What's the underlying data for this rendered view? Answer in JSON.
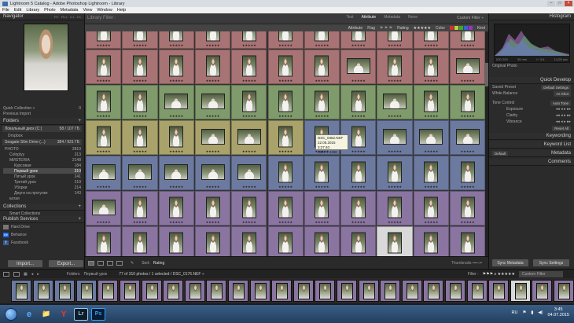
{
  "window": {
    "title": "Lightroom 5 Catalog - Adobe Photoshop Lightroom - Library",
    "controls": [
      "–",
      "□",
      "×"
    ]
  },
  "menu": [
    "File",
    "Edit",
    "Library",
    "Photo",
    "Metadata",
    "View",
    "Window",
    "Help"
  ],
  "left_panel": {
    "navigator_title": "Navigator",
    "navigator_zoom": [
      "FIT",
      "FILL",
      "1:1",
      "3:1"
    ],
    "catalog_items": [
      {
        "label": "Quick Collection +",
        "count": "0"
      },
      {
        "label": "Previous Import",
        "count": ""
      }
    ],
    "folders_title": "Folders",
    "volumes": [
      {
        "label": "Локальный диск (C:)",
        "info": "58 / 107 ГБ"
      },
      {
        "label": "Seagate Slim Drive (...)",
        "info": "384 / 931 ГБ"
      }
    ],
    "folders": [
      {
        "label": "Dropbox",
        "count": ""
      },
      {
        "label": "PHOTO",
        "count": "2810"
      },
      {
        "label": "Coloplyy",
        "count": "313"
      },
      {
        "label": "МИSTERIA",
        "count": "2148"
      },
      {
        "label": "Курсовая",
        "count": "184"
      },
      {
        "label": "Первый урок",
        "count": "310",
        "selected": true
      },
      {
        "label": "Пятый урок",
        "count": "241"
      },
      {
        "label": "Третий урок",
        "count": "219"
      },
      {
        "label": "Уборки",
        "count": "214"
      },
      {
        "label": "Джуги на прогулке",
        "count": "143"
      },
      {
        "label": "катая",
        "count": ""
      }
    ],
    "collections_title": "Collections",
    "smart_collections": "Smart Collections",
    "publish_title": "Publish Services",
    "publish_items": [
      "Hard Drive",
      "Behance",
      "Facebook"
    ],
    "import_label": "Import...",
    "export_label": "Export..."
  },
  "center": {
    "filter_title": "Library Filter :",
    "filter_tabs": [
      "Text",
      "Attribute",
      "Metadata",
      "None"
    ],
    "filter_custom": "Custom Filter ÷",
    "attr_items": [
      "Attribute",
      "Flag",
      "Rating",
      "★★★★★",
      "Color",
      "Kind"
    ],
    "tooltip": {
      "name": "DSC_0382.NEF",
      "date": "22.05.2015 3:27:40",
      "size": "2848 x 4288"
    },
    "sort_label": "Sort:",
    "sort_value": "Rating",
    "thumbnails_label": "Thumbnails"
  },
  "right_panel": {
    "histogram_title": "Histogram",
    "hist_readout": [
      "ISO 200",
      "35 mm",
      "f / 3.5",
      "1/125 sec"
    ],
    "original_photo": "Original Photo",
    "quick_develop_title": "Quick Develop",
    "saved_preset_label": "Saved Preset",
    "saved_preset_value": "Default Settings",
    "white_balance_label": "White Balance",
    "white_balance_value": "As Shot",
    "tone_control_label": "Tone Control",
    "tone_control_value": "Auto Tone",
    "tone_rows": [
      "Exposure",
      "Clarity",
      "Vibrance"
    ],
    "reset_all": "Reset All",
    "keywording_title": "Keywording",
    "keyword_list_title": "Keyword List",
    "metadata_title": "Metadata",
    "metadata_value": "Default",
    "comments_title": "Comments",
    "sync_metadata": "Sync Metadata",
    "sync_settings": "Sync Settings"
  },
  "filmstrip": {
    "folder_label": "Folders",
    "folder_name": "Первый урок",
    "status": "77 of 310 photos / 1 selected / DSC_0176.NEF ÷",
    "filter_label": "Filter :",
    "filter_value": "Custom Filter"
  },
  "taskbar": {
    "apps": [
      "e",
      "📁",
      "Y",
      "Lr",
      "Ps"
    ],
    "lang": "RU",
    "time": "3:45",
    "date": "04.07.2015"
  },
  "colors": {
    "red": "#a87374",
    "yellow": "#a9a26a",
    "green": "#7f9a6b",
    "blue": "#6d7aa0",
    "purple": "#8a74a0",
    "selected": "#d9d9d9"
  }
}
